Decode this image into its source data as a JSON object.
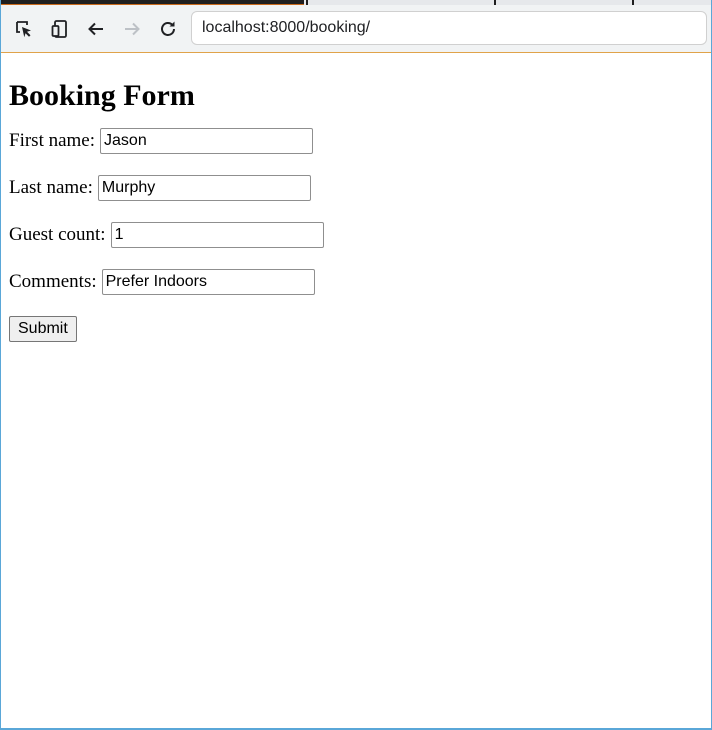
{
  "browser": {
    "url": "localhost:8000/booking/",
    "icons": [
      "inspect-icon",
      "device-toggle-icon",
      "back-arrow-icon",
      "forward-arrow-icon",
      "reload-icon"
    ]
  },
  "page": {
    "title": "Booking Form",
    "fields": [
      {
        "label": "First name:",
        "value": "Jason"
      },
      {
        "label": "Last name:",
        "value": "Murphy"
      },
      {
        "label": "Guest count:",
        "value": "1"
      },
      {
        "label": "Comments:",
        "value": "Prefer Indoors"
      }
    ],
    "submit_label": "Submit"
  }
}
